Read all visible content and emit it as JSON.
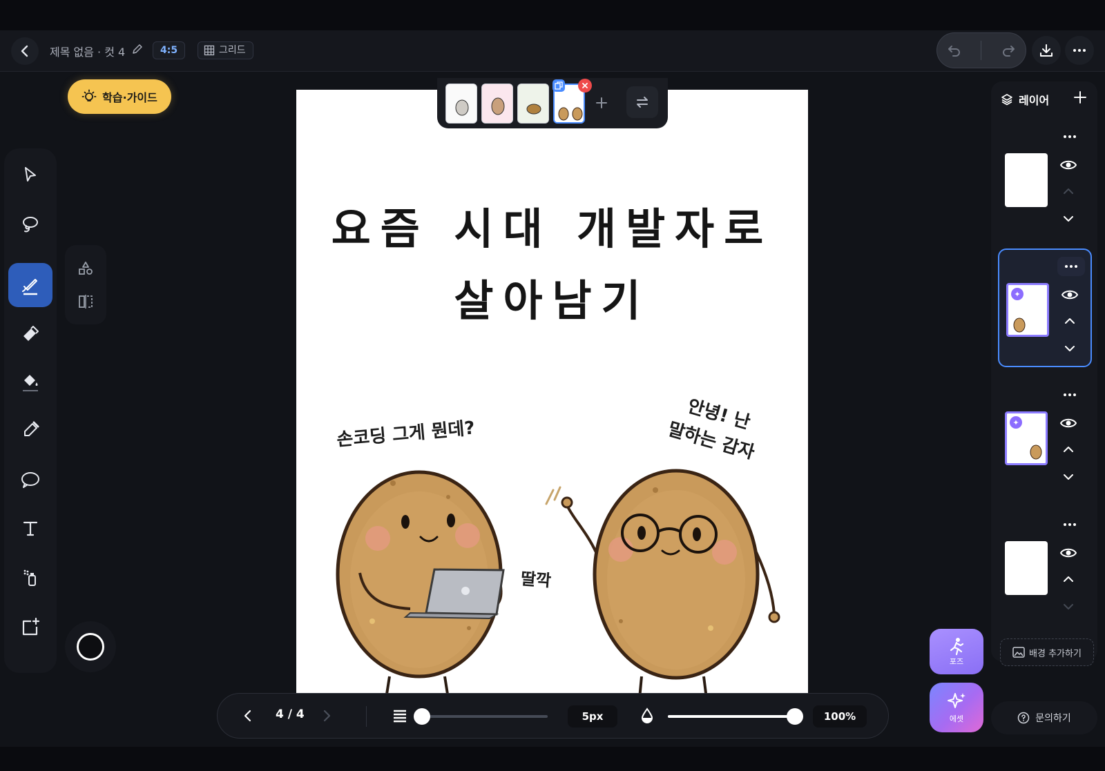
{
  "header": {
    "back_label": "",
    "title": "제목 없음 · 컷 4",
    "ratio": "4:5",
    "grid_label": "그리드"
  },
  "guide": {
    "label": "학습·가이드"
  },
  "toolbar": {
    "tools": [
      "select-tool",
      "lasso-tool",
      "brush-tool",
      "eraser-tool",
      "fill-tool",
      "eyedropper-tool",
      "speech-bubble-tool",
      "text-tool",
      "spray-tool",
      "add-frame-tool"
    ],
    "active": "brush-tool"
  },
  "canvas": {
    "title_line1": "요즘 시대 개발자로",
    "title_line2": "살아남기",
    "bubble_left": "손코딩 그게 뭔데?",
    "bubble_right_line1": "안녕! 난",
    "bubble_right_line2": "말하는 감자",
    "sfx": "딸깍"
  },
  "page_strip": {
    "count": 4,
    "selected": 4
  },
  "bottom_bar": {
    "page_indicator": "4 / 4",
    "brush_size": "5px",
    "brush_size_level": 0,
    "opacity": "100%",
    "opacity_level": 1.0
  },
  "layers": {
    "title": "레이어",
    "items": [
      {
        "name": "layer-1",
        "ai": false,
        "selected": false
      },
      {
        "name": "layer-2",
        "ai": true,
        "selected": true
      },
      {
        "name": "layer-3",
        "ai": true,
        "selected": false
      },
      {
        "name": "layer-4",
        "ai": false,
        "selected": false
      }
    ],
    "add_background_label": "배경 추가하기"
  },
  "actions": {
    "pose_label": "포즈",
    "asset_label": "에셋",
    "contact_label": "문의하기"
  },
  "colors": {
    "accent": "#2e5dba",
    "guide": "#f5c451",
    "selection": "#4a8cff",
    "brush_color": "#000000"
  }
}
